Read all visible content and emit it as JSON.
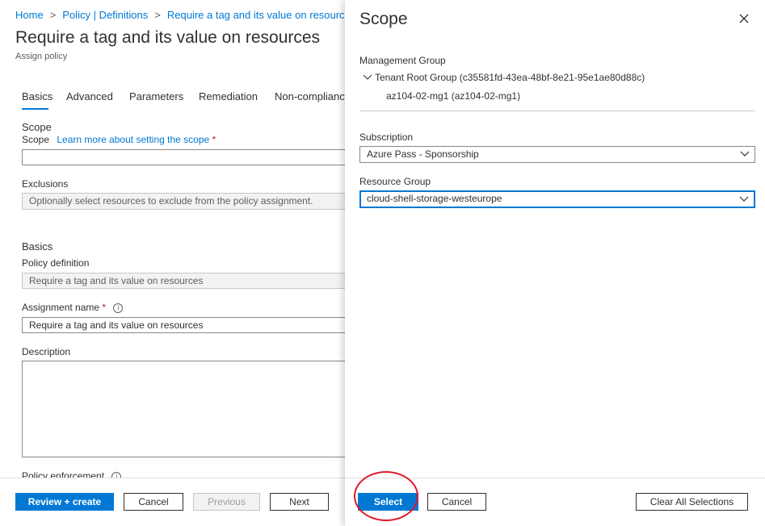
{
  "breadcrumb": {
    "items": [
      "Home",
      "Policy | Definitions",
      "Require a tag and its value on resources"
    ]
  },
  "page": {
    "title": "Require a tag and its value on resources",
    "subtitle": "Assign policy"
  },
  "tabs": [
    {
      "label": "Basics",
      "selected": true
    },
    {
      "label": "Advanced"
    },
    {
      "label": "Parameters"
    },
    {
      "label": "Remediation"
    },
    {
      "label": "Non-complianc"
    }
  ],
  "scope_section": {
    "heading": "Scope",
    "scope_label": "Scope",
    "learn_more_link": "Learn more about setting the scope",
    "required_marker": "*",
    "exclusions_label": "Exclusions",
    "exclusions_placeholder": "Optionally select resources to exclude from the policy assignment."
  },
  "basics_section": {
    "heading": "Basics",
    "policy_definition_label": "Policy definition",
    "policy_definition_value": "Require a tag and its value on resources",
    "assignment_name_label": "Assignment name",
    "assignment_name_required": "*",
    "assignment_name_value": "Require a tag and its value on resources",
    "description_label": "Description",
    "policy_enforcement_label": "Policy enforcement"
  },
  "footer": {
    "review_create": "Review + create",
    "cancel": "Cancel",
    "previous": "Previous",
    "next": "Next"
  },
  "scope_panel": {
    "title": "Scope",
    "management_group_label": "Management Group",
    "tenant_root": "Tenant Root Group (c35581fd-43ea-48bf-8e21-95e1ae80d88c)",
    "mg_child": "az104-02-mg1 (az104-02-mg1)",
    "subscription_label": "Subscription",
    "subscription_value": "Azure Pass - Sponsorship",
    "resource_group_label": "Resource Group",
    "resource_group_value": "cloud-shell-storage-westeurope",
    "select_button": "Select",
    "cancel_button": "Cancel",
    "clear_button": "Clear All Selections"
  },
  "colors": {
    "accent": "#0078d4",
    "annotation": "#e2172a"
  },
  "icons": [
    "chevron-right-icon",
    "info-icon",
    "close-icon",
    "chevron-down-icon",
    "tree-expand-icon"
  ]
}
